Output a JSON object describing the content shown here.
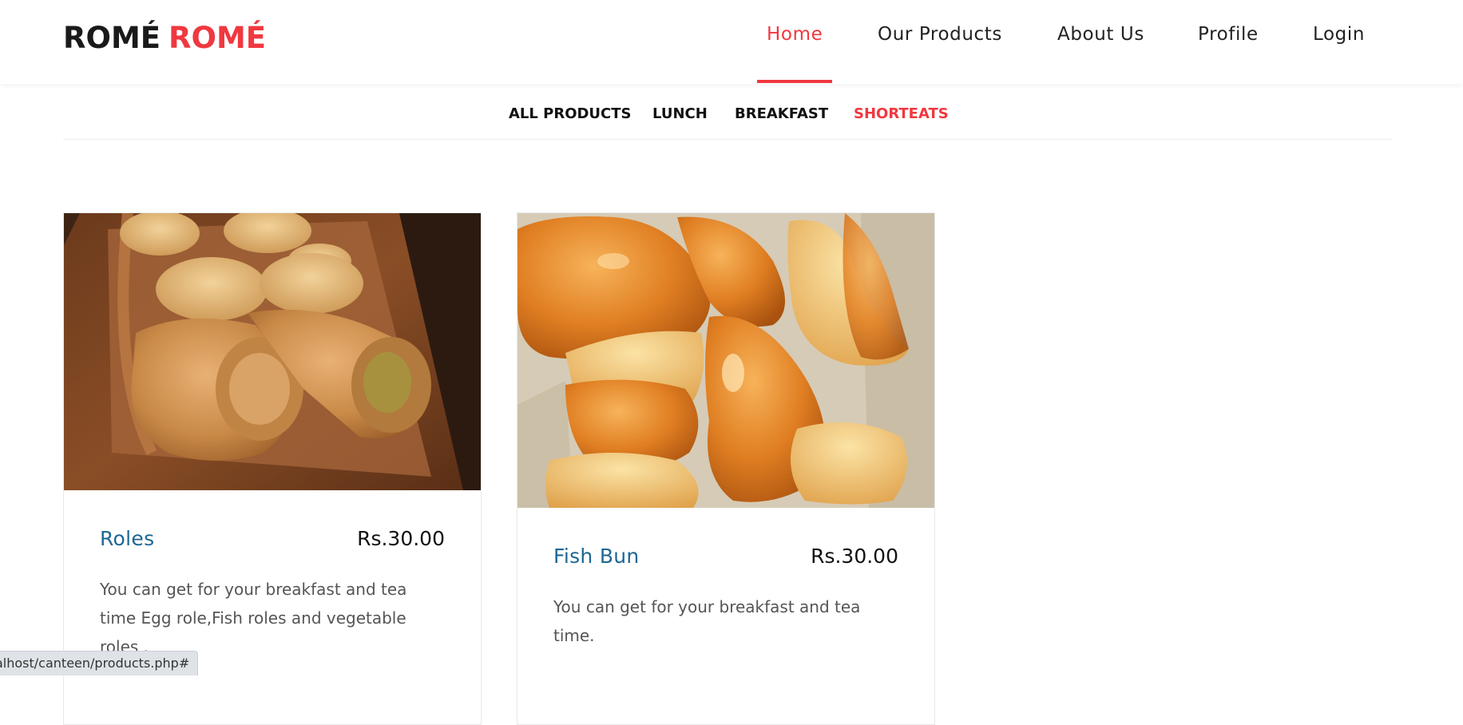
{
  "header": {
    "logo_part1": "ROMÉ",
    "logo_part2": "ROMÉ",
    "nav": [
      {
        "label": "Home",
        "active": true
      },
      {
        "label": "Our Products",
        "active": false
      },
      {
        "label": "About Us",
        "active": false
      },
      {
        "label": "Profile",
        "active": false
      },
      {
        "label": "Login",
        "active": false
      }
    ]
  },
  "categories": [
    {
      "label": "ALL PRODUCTS",
      "active": false
    },
    {
      "label": "LUNCH",
      "active": false
    },
    {
      "label": "BREAKFAST",
      "active": false
    },
    {
      "label": "SHORTEATS",
      "active": true
    }
  ],
  "products": [
    {
      "title": "Roles",
      "price": "Rs.30.00",
      "description": "You can get for your breakfast and tea time Egg role,Fish roles and vegetable roles ."
    },
    {
      "title": "Fish Bun",
      "price": "Rs.30.00",
      "description": "You can get for your breakfast and tea time."
    }
  ],
  "status_bar": {
    "url": "alhost/canteen/products.php#"
  },
  "colors": {
    "accent": "#f0383f",
    "title_blue": "#1e6795",
    "text_dark": "#1a1a1a",
    "text_muted": "#555555"
  }
}
